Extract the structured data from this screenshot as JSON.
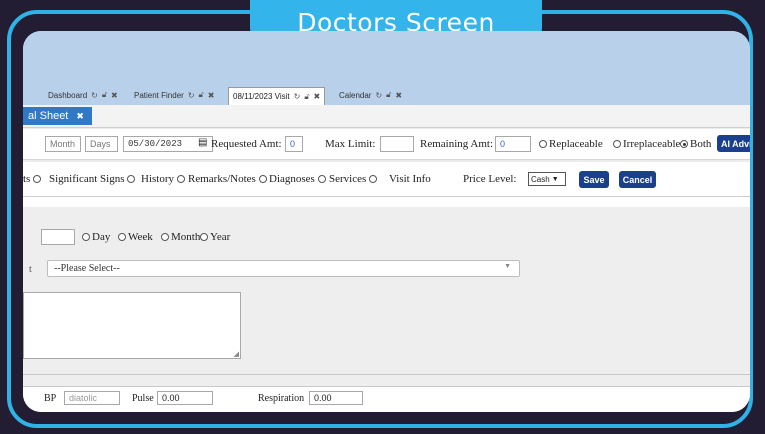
{
  "banner": {
    "title": "Doctors Screen"
  },
  "tabs": [
    {
      "label": "Dashboard"
    },
    {
      "label": "Patient Finder"
    },
    {
      "label": "08/11/2023 Visit"
    },
    {
      "label": "Calendar"
    }
  ],
  "subtab": {
    "label": "al Sheet"
  },
  "row1": {
    "month_label": "Month",
    "days_label": "Days",
    "date_value": "05/30/2023",
    "requested_label": "Requested Amt:",
    "requested_value": "0",
    "max_limit_label": "Max Limit:",
    "remaining_label": "Remaining Amt:",
    "remaining_value": "0",
    "radio_replaceable": "Replaceable",
    "radio_irreplaceable": "Irreplaceable",
    "radio_both": "Both",
    "ai_button": "AI Advi"
  },
  "row2": {
    "opt_ts": "ts",
    "opt_signs": "Significant Signs",
    "opt_history": "History",
    "opt_remarks": "Remarks/Notes",
    "opt_diagnoses": "Diagnoses",
    "opt_services": "Services",
    "opt_visit": "Visit Info",
    "price_level_label": "Price Level:",
    "price_level_value": "Cash",
    "save_label": "Save",
    "cancel_label": "Cancel"
  },
  "duration": {
    "day": "Day",
    "week": "Week",
    "month": "Month",
    "year": "Year"
  },
  "select": {
    "placeholder": "--Please Select--",
    "prefix": "t"
  },
  "bottom": {
    "bp_label": "BP",
    "bp_placeholder": "diatolic",
    "pulse_label": "Pulse",
    "pulse_value": "0.00",
    "respiration_label": "Respiration",
    "respiration_value": "0.00"
  },
  "colors": {
    "accent": "#2fb3e6",
    "button": "#1a3f8c",
    "tab_active": "#2f79c6"
  }
}
